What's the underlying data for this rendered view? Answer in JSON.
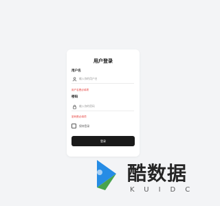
{
  "form": {
    "title": "用户登录",
    "username": {
      "label": "用户名",
      "placeholder": "输入你的用户名",
      "error": "用户名是必填项"
    },
    "password": {
      "label": "密码",
      "placeholder": "输入你的密码",
      "error": "密码是必填项"
    },
    "remember_label": "保持登录",
    "submit_label": "登录"
  },
  "watermark": {
    "text": "酷数据",
    "subtext": "KUIDC"
  },
  "colors": {
    "background": "#f3f4f6",
    "card": "#ffffff",
    "error": "#e53935",
    "button": "#1a1a1a",
    "watermark_blue": "#1e88e5",
    "watermark_green": "#43a047"
  }
}
